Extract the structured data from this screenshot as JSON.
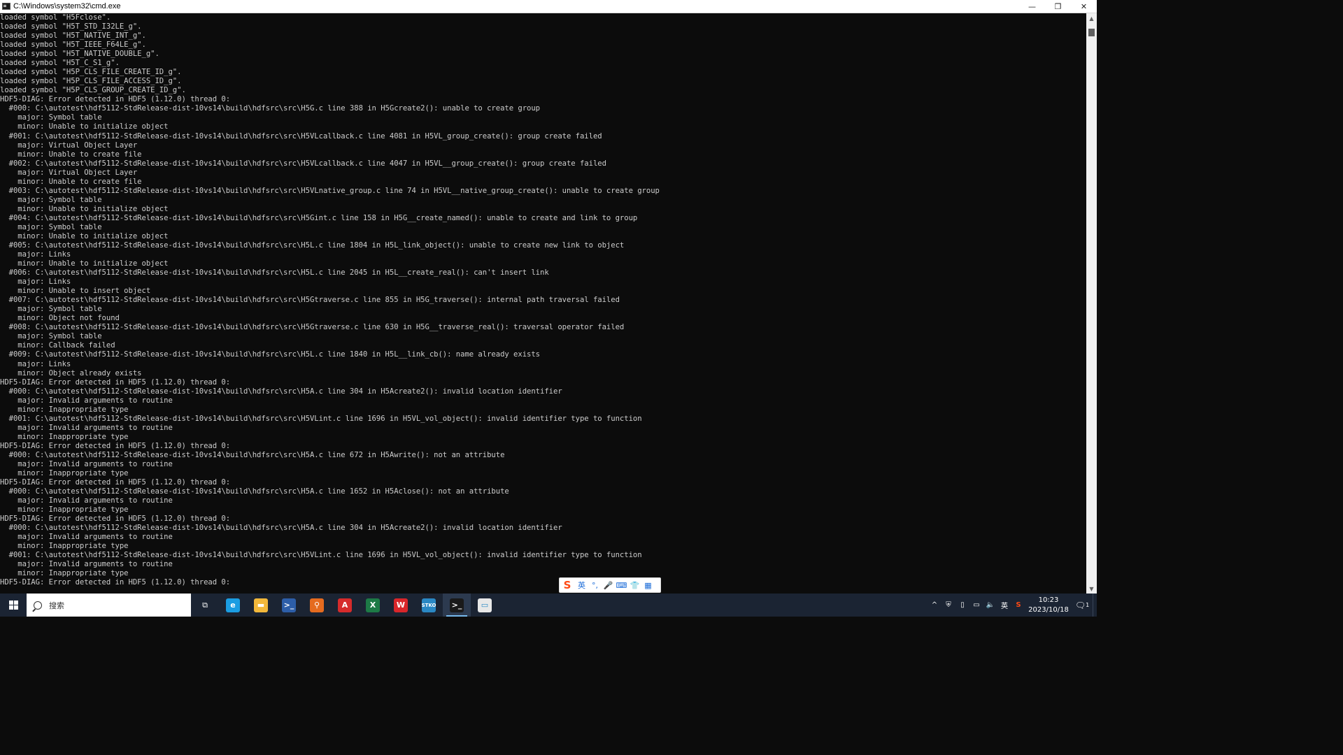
{
  "window": {
    "title": "C:\\Windows\\system32\\cmd.exe",
    "minimize_glyph": "—",
    "restore_glyph": "❐",
    "close_glyph": "✕"
  },
  "console": {
    "lines": [
      "loaded symbol \"H5Fclose\".",
      "loaded symbol \"H5T_STD_I32LE_g\".",
      "loaded symbol \"H5T_NATIVE_INT_g\".",
      "loaded symbol \"H5T_IEEE_F64LE_g\".",
      "loaded symbol \"H5T_NATIVE_DOUBLE_g\".",
      "loaded symbol \"H5T_C_S1_g\".",
      "loaded symbol \"H5P_CLS_FILE_CREATE_ID_g\".",
      "loaded symbol \"H5P_CLS_FILE_ACCESS_ID_g\".",
      "loaded symbol \"H5P_CLS_GROUP_CREATE_ID_g\".",
      "HDF5-DIAG: Error detected in HDF5 (1.12.0) thread 0:",
      "  #000: C:\\autotest\\hdf5112-StdRelease-dist-10vs14\\build\\hdfsrc\\src\\H5G.c line 388 in H5Gcreate2(): unable to create group",
      "    major: Symbol table",
      "    minor: Unable to initialize object",
      "  #001: C:\\autotest\\hdf5112-StdRelease-dist-10vs14\\build\\hdfsrc\\src\\H5VLcallback.c line 4081 in H5VL_group_create(): group create failed",
      "    major: Virtual Object Layer",
      "    minor: Unable to create file",
      "  #002: C:\\autotest\\hdf5112-StdRelease-dist-10vs14\\build\\hdfsrc\\src\\H5VLcallback.c line 4047 in H5VL__group_create(): group create failed",
      "    major: Virtual Object Layer",
      "    minor: Unable to create file",
      "  #003: C:\\autotest\\hdf5112-StdRelease-dist-10vs14\\build\\hdfsrc\\src\\H5VLnative_group.c line 74 in H5VL__native_group_create(): unable to create group",
      "    major: Symbol table",
      "    minor: Unable to initialize object",
      "  #004: C:\\autotest\\hdf5112-StdRelease-dist-10vs14\\build\\hdfsrc\\src\\H5Gint.c line 158 in H5G__create_named(): unable to create and link to group",
      "    major: Symbol table",
      "    minor: Unable to initialize object",
      "  #005: C:\\autotest\\hdf5112-StdRelease-dist-10vs14\\build\\hdfsrc\\src\\H5L.c line 1804 in H5L_link_object(): unable to create new link to object",
      "    major: Links",
      "    minor: Unable to initialize object",
      "  #006: C:\\autotest\\hdf5112-StdRelease-dist-10vs14\\build\\hdfsrc\\src\\H5L.c line 2045 in H5L__create_real(): can't insert link",
      "    major: Links",
      "    minor: Unable to insert object",
      "  #007: C:\\autotest\\hdf5112-StdRelease-dist-10vs14\\build\\hdfsrc\\src\\H5Gtraverse.c line 855 in H5G_traverse(): internal path traversal failed",
      "    major: Symbol table",
      "    minor: Object not found",
      "  #008: C:\\autotest\\hdf5112-StdRelease-dist-10vs14\\build\\hdfsrc\\src\\H5Gtraverse.c line 630 in H5G__traverse_real(): traversal operator failed",
      "    major: Symbol table",
      "    minor: Callback failed",
      "  #009: C:\\autotest\\hdf5112-StdRelease-dist-10vs14\\build\\hdfsrc\\src\\H5L.c line 1840 in H5L__link_cb(): name already exists",
      "    major: Links",
      "    minor: Object already exists",
      "HDF5-DIAG: Error detected in HDF5 (1.12.0) thread 0:",
      "  #000: C:\\autotest\\hdf5112-StdRelease-dist-10vs14\\build\\hdfsrc\\src\\H5A.c line 304 in H5Acreate2(): invalid location identifier",
      "    major: Invalid arguments to routine",
      "    minor: Inappropriate type",
      "  #001: C:\\autotest\\hdf5112-StdRelease-dist-10vs14\\build\\hdfsrc\\src\\H5VLint.c line 1696 in H5VL_vol_object(): invalid identifier type to function",
      "    major: Invalid arguments to routine",
      "    minor: Inappropriate type",
      "HDF5-DIAG: Error detected in HDF5 (1.12.0) thread 0:",
      "  #000: C:\\autotest\\hdf5112-StdRelease-dist-10vs14\\build\\hdfsrc\\src\\H5A.c line 672 in H5Awrite(): not an attribute",
      "    major: Invalid arguments to routine",
      "    minor: Inappropriate type",
      "HDF5-DIAG: Error detected in HDF5 (1.12.0) thread 0:",
      "  #000: C:\\autotest\\hdf5112-StdRelease-dist-10vs14\\build\\hdfsrc\\src\\H5A.c line 1652 in H5Aclose(): not an attribute",
      "    major: Invalid arguments to routine",
      "    minor: Inappropriate type",
      "HDF5-DIAG: Error detected in HDF5 (1.12.0) thread 0:",
      "  #000: C:\\autotest\\hdf5112-StdRelease-dist-10vs14\\build\\hdfsrc\\src\\H5A.c line 304 in H5Acreate2(): invalid location identifier",
      "    major: Invalid arguments to routine",
      "    minor: Inappropriate type",
      "  #001: C:\\autotest\\hdf5112-StdRelease-dist-10vs14\\build\\hdfsrc\\src\\H5VLint.c line 1696 in H5VL_vol_object(): invalid identifier type to function",
      "    major: Invalid arguments to routine",
      "    minor: Inappropriate type",
      "HDF5-DIAG: Error detected in HDF5 (1.12.0) thread 0:"
    ]
  },
  "ime": {
    "logo": "S",
    "lang": "英",
    "items": [
      "°,",
      "🎤",
      "⌨",
      "👕",
      "▦"
    ]
  },
  "taskbar": {
    "search_placeholder": "搜索",
    "apps": [
      {
        "icon": "task-view-icon",
        "glyph": "⧉",
        "bg": "transparent"
      },
      {
        "icon": "edge-icon",
        "glyph": "e",
        "bg": "#1b9de2"
      },
      {
        "icon": "file-explorer-icon",
        "glyph": "▬",
        "bg": "#f2b83b"
      },
      {
        "icon": "powershell-icon",
        "glyph": ">_",
        "bg": "#2d5ea8"
      },
      {
        "icon": "search-app-icon",
        "glyph": "⚲",
        "bg": "#e56b1f"
      },
      {
        "icon": "acrobat-icon",
        "glyph": "A",
        "bg": "#d62b2b"
      },
      {
        "icon": "excel-icon",
        "glyph": "X",
        "bg": "#1d7a46"
      },
      {
        "icon": "wps-icon",
        "glyph": "W",
        "bg": "#d9262a"
      },
      {
        "icon": "stko-icon",
        "glyph": "STKO",
        "bg": "#2a88c4"
      },
      {
        "icon": "cmd-icon",
        "glyph": ">_",
        "bg": "#1a1a1a"
      },
      {
        "icon": "window-app-icon",
        "glyph": "▭",
        "bg": "#e8e8e8"
      }
    ],
    "tray": {
      "chevron": "^",
      "lang": "英",
      "time": "10:23",
      "date": "2023/10/18",
      "notification_count": "1"
    }
  }
}
